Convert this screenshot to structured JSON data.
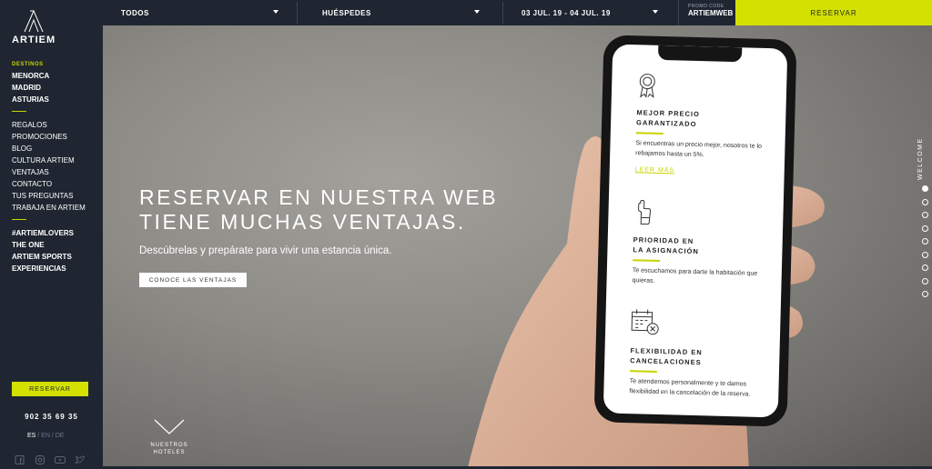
{
  "brand": {
    "name": "ARTIEM"
  },
  "sidebar": {
    "destinos_label": "DESTINOS",
    "destinos": [
      "MENORCA",
      "MADRID",
      "ASTURIAS"
    ],
    "links": [
      "REGALOS",
      "PROMOCIONES",
      "BLOG",
      "CULTURA ARTIEM",
      "VENTAJAS",
      "CONTACTO",
      "TUS PREGUNTAS",
      "TRABAJA EN ARTIEM"
    ],
    "extras": [
      "#ARTIEMLOVERS",
      "THE ONE",
      "ARTIEM SPORTS",
      "EXPERIENCIAS"
    ],
    "reserve_label": "RESERVAR",
    "phone": "902 35 69 35",
    "lang_active": "ES",
    "lang_others": " / EN / DE",
    "socials": [
      "facebook-icon",
      "instagram-icon",
      "youtube-icon",
      "twitter-icon"
    ]
  },
  "topbar": {
    "hotel_select": "TODOS",
    "guests_select": "HUÉSPEDES",
    "dates_select": "03 JUL. 19 - 04 JUL. 19",
    "promo_label": "PROMO CODE",
    "promo_code": "ARTIEMWEB",
    "reserve_label": "RESERVAR"
  },
  "hero": {
    "title_line1": "RESERVAR EN NUESTRA WEB",
    "title_line2": "TIENE MUCHAS VENTAJAS.",
    "subtitle": "Descúbrelas y prepárate para vivir una estancia única.",
    "cta": "CONOCE LAS VENTAJAS",
    "scroll_line1": "NUESTROS",
    "scroll_line2": "HOTELES",
    "welcome": "WELCOME",
    "slide_count": 9,
    "active_slide": 1
  },
  "phone_screen": {
    "features": [
      {
        "title_1": "MEJOR PRECIO",
        "title_2": "GARANTIZADO",
        "text": "Si encuentras un precio mejor, nosotros te lo rebajamos hasta un 5%.",
        "link": "LEER MÁS",
        "icon": "award-ribbon-icon"
      },
      {
        "title_1": "PRIORIDAD EN",
        "title_2": "LA ASIGNACIÓN",
        "text": "Te escuchamos para darte la habitación que quieras.",
        "icon": "thumbs-up-icon"
      },
      {
        "title_1": "FLEXIBILIDAD EN",
        "title_2": "CANCELACIONES",
        "text": "Te atendemos personalmente y te damos flexibilidad en la cancelación de la reserva.",
        "icon": "calendar-cancel-icon"
      }
    ]
  },
  "colors": {
    "accent": "#d4e000",
    "dark": "#1f2631"
  }
}
